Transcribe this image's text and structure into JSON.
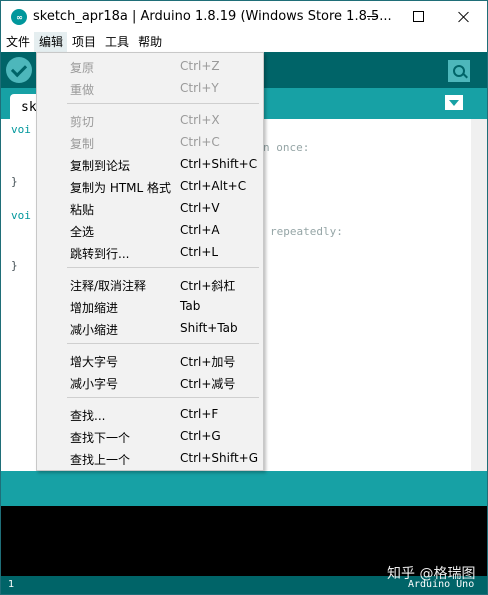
{
  "window": {
    "title": "sketch_apr18a | Arduino 1.8.19 (Windows Store 1.8.5...",
    "logo_text": "∞"
  },
  "menubar": [
    "文件",
    "编辑",
    "项目",
    "工具",
    "帮助"
  ],
  "tab": {
    "label": "sk"
  },
  "editor": {
    "lines": [
      {
        "prefix": "voi",
        "text": ""
      },
      {
        "prefix": "  //",
        "text": "n once:"
      },
      {
        "prefix": "}",
        "text": ""
      },
      {
        "prefix": "voi",
        "text": ""
      },
      {
        "prefix": "  //",
        "text": "repeatedly:"
      },
      {
        "prefix": "}",
        "text": ""
      }
    ]
  },
  "edit_menu": {
    "groups": [
      [
        {
          "label": "复原",
          "shortcut": "Ctrl+Z",
          "enabled": false
        },
        {
          "label": "重做",
          "shortcut": "Ctrl+Y",
          "enabled": false
        }
      ],
      [
        {
          "label": "剪切",
          "shortcut": "Ctrl+X",
          "enabled": false
        },
        {
          "label": "复制",
          "shortcut": "Ctrl+C",
          "enabled": false
        },
        {
          "label": "复制到论坛",
          "shortcut": "Ctrl+Shift+C",
          "enabled": true
        },
        {
          "label": "复制为 HTML 格式",
          "shortcut": "Ctrl+Alt+C",
          "enabled": true
        },
        {
          "label": "粘贴",
          "shortcut": "Ctrl+V",
          "enabled": true
        },
        {
          "label": "全选",
          "shortcut": "Ctrl+A",
          "enabled": true
        },
        {
          "label": "跳转到行...",
          "shortcut": "Ctrl+L",
          "enabled": true
        }
      ],
      [
        {
          "label": "注释/取消注释",
          "shortcut": "Ctrl+斜杠",
          "enabled": true
        },
        {
          "label": "增加缩进",
          "shortcut": "Tab",
          "enabled": true
        },
        {
          "label": "减小缩进",
          "shortcut": "Shift+Tab",
          "enabled": true
        }
      ],
      [
        {
          "label": "增大字号",
          "shortcut": "Ctrl+加号",
          "enabled": true
        },
        {
          "label": "减小字号",
          "shortcut": "Ctrl+减号",
          "enabled": true
        }
      ],
      [
        {
          "label": "查找...",
          "shortcut": "Ctrl+F",
          "enabled": true
        },
        {
          "label": "查找下一个",
          "shortcut": "Ctrl+G",
          "enabled": true
        },
        {
          "label": "查找上一个",
          "shortcut": "Ctrl+Shift+G",
          "enabled": true
        }
      ]
    ]
  },
  "footer": {
    "line_number": "1",
    "board": "Arduino Uno"
  },
  "watermark": "知乎 @格瑞图",
  "colors": {
    "arduino_dark_teal": "#006468",
    "arduino_teal": "#17a1a5",
    "arduino_button": "#4db7bb",
    "menu_bg": "#f2f2f2",
    "disabled_text": "#9a9a9a"
  }
}
